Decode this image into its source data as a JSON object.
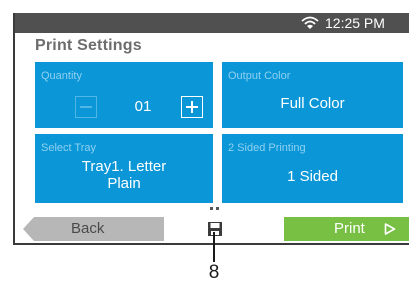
{
  "status_bar": {
    "wifi_icon": "wifi-icon",
    "time": "12:25 PM"
  },
  "title": "Print Settings",
  "quantity": {
    "label": "Quantity",
    "value": "01",
    "minus_icon": "minus-icon",
    "plus_icon": "plus-icon"
  },
  "output_color": {
    "label": "Output Color",
    "value": "Full Color"
  },
  "select_tray": {
    "label": "Select Tray",
    "value_line1": "Tray1. Letter",
    "value_line2": "Plain"
  },
  "two_sided": {
    "label": "2 Sided Printing",
    "value": "1 Sided"
  },
  "footer": {
    "back_label": "Back",
    "save_icon": "save-icon",
    "print_label": "Print",
    "print_icon": "play-arrow-icon"
  },
  "callout": {
    "number": "8"
  },
  "colors": {
    "status_bar": "#505050",
    "tile_blue": "#0b97d7",
    "print_green": "#78c043",
    "back_gray": "#b7b7b7",
    "title_gray": "#6d6d6d"
  }
}
